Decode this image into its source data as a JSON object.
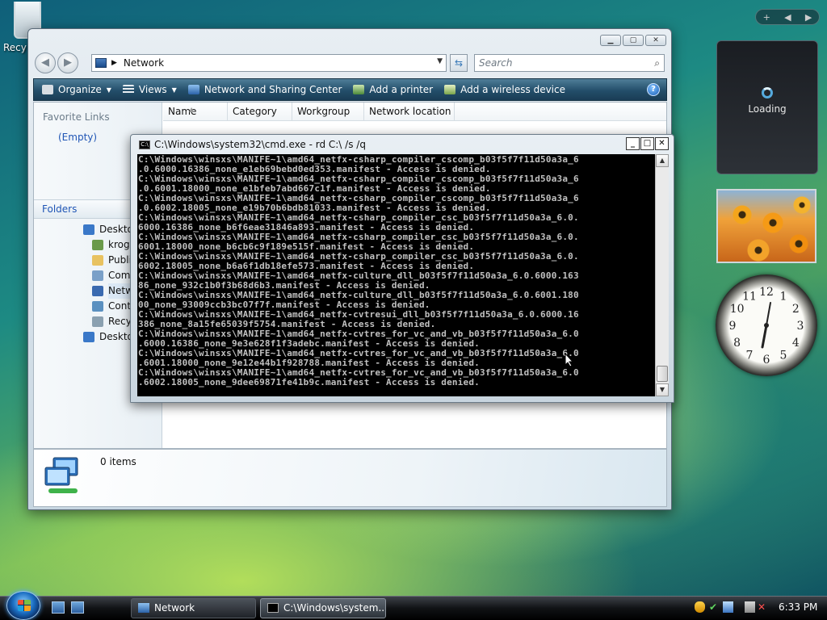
{
  "desktop": {
    "recycle_bin_label": "Recy"
  },
  "sidebar": {
    "controls": {
      "add": "+",
      "prev": "◀",
      "next": "▶"
    },
    "loading_gadget": {
      "text": "Loading"
    },
    "clock": {
      "numerals": [
        "12",
        "1",
        "2",
        "3",
        "4",
        "5",
        "6",
        "7",
        "8",
        "9",
        "10",
        "11"
      ]
    }
  },
  "explorer": {
    "address": {
      "path": "Network"
    },
    "search": {
      "placeholder": "Search"
    },
    "toolbar": {
      "organize": "Organize",
      "views": "Views",
      "network_sharing_center": "Network and Sharing Center",
      "add_printer": "Add a printer",
      "add_wireless": "Add a wireless device",
      "help": "?"
    },
    "nav_pane": {
      "favorite_links_title": "Favorite Links",
      "favorites_empty": "(Empty)",
      "folders_title": "Folders",
      "tree": [
        {
          "label": "Desktop",
          "icon": "desktop-icon",
          "color": "#3a78c8"
        },
        {
          "label": "kroger",
          "icon": "user-folder-icon",
          "color": "#6a9a4a"
        },
        {
          "label": "Public",
          "icon": "folder-icon",
          "color": "#e8c260"
        },
        {
          "label": "Computer",
          "icon": "computer-icon",
          "color": "#7aa0c8"
        },
        {
          "label": "Network",
          "icon": "network-icon",
          "color": "#3a6ab0"
        },
        {
          "label": "Control Pane",
          "icon": "control-panel-icon",
          "color": "#5a90c0"
        },
        {
          "label": "Recycle Bin",
          "icon": "recycle-bin-icon",
          "color": "#8aa0b0"
        },
        {
          "label": "Desktop",
          "icon": "desktop-icon",
          "color": "#3a78c8"
        }
      ]
    },
    "columns": [
      "Name",
      "Category",
      "Workgroup",
      "Network location"
    ],
    "details": {
      "count": "0 items"
    }
  },
  "console": {
    "title": "C:\\Windows\\system32\\cmd.exe - rd  C:\\ /s /q",
    "lines": [
      "C:\\Windows\\winsxs\\MANIFE~1\\amd64_netfx-csharp_compiler_cscomp_b03f5f7f11d50a3a_6",
      ".0.6000.16386_none_e1eb69bebd0ed353.manifest - Access is denied.",
      "C:\\Windows\\winsxs\\MANIFE~1\\amd64_netfx-csharp_compiler_cscomp_b03f5f7f11d50a3a_6",
      ".0.6001.18000_none_e1bfeb7abd667c1f.manifest - Access is denied.",
      "C:\\Windows\\winsxs\\MANIFE~1\\amd64_netfx-csharp_compiler_cscomp_b03f5f7f11d50a3a_6",
      ".0.6002.18005_none_e19b70b6bdb81033.manifest - Access is denied.",
      "C:\\Windows\\winsxs\\MANIFE~1\\amd64_netfx-csharp_compiler_csc_b03f5f7f11d50a3a_6.0.",
      "6000.16386_none_b6f6eae31846a893.manifest - Access is denied.",
      "C:\\Windows\\winsxs\\MANIFE~1\\amd64_netfx-csharp_compiler_csc_b03f5f7f11d50a3a_6.0.",
      "6001.18000_none_b6cb6c9f189e515f.manifest - Access is denied.",
      "C:\\Windows\\winsxs\\MANIFE~1\\amd64_netfx-csharp_compiler_csc_b03f5f7f11d50a3a_6.0.",
      "6002.18005_none_b6a6f1db18efe573.manifest - Access is denied.",
      "C:\\Windows\\winsxs\\MANIFE~1\\amd64_netfx-culture_dll_b03f5f7f11d50a3a_6.0.6000.163",
      "86_none_932c1b0f3b68d6b3.manifest - Access is denied.",
      "C:\\Windows\\winsxs\\MANIFE~1\\amd64_netfx-culture_dll_b03f5f7f11d50a3a_6.0.6001.180",
      "00_none_93009ccb3bc07f7f.manifest - Access is denied.",
      "C:\\Windows\\winsxs\\MANIFE~1\\amd64_netfx-cvtresui_dll_b03f5f7f11d50a3a_6.0.6000.16",
      "386_none_8a15fe65039f5754.manifest - Access is denied.",
      "C:\\Windows\\winsxs\\MANIFE~1\\amd64_netfx-cvtres_for_vc_and_vb_b03f5f7f11d50a3a_6.0",
      ".6000.16386_none_9e3e628f1f3adebc.manifest - Access is denied.",
      "C:\\Windows\\winsxs\\MANIFE~1\\amd64_netfx-cvtres_for_vc_and_vb_b03f5f7f11d50a3a_6.0",
      ".6001.18000_none_9e12e44b1f928788.manifest - Access is denied.",
      "C:\\Windows\\winsxs\\MANIFE~1\\amd64_netfx-cvtres_for_vc_and_vb_b03f5f7f11d50a3a_6.0",
      ".6002.18005_none_9dee69871fe41b9c.manifest - Access is denied."
    ]
  },
  "taskbar": {
    "buttons": [
      {
        "label": "Network",
        "icon": "network-icon"
      },
      {
        "label": "C:\\Windows\\system...",
        "icon": "cmd-icon"
      }
    ],
    "clock": "6:33 PM"
  }
}
